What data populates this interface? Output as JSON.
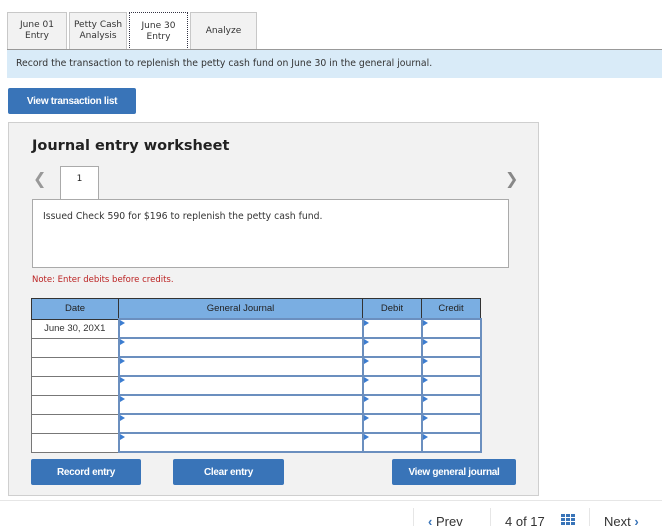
{
  "tabs": [
    {
      "label": "June 01 Entry",
      "active": false
    },
    {
      "label": "Petty Cash Analysis",
      "active": false
    },
    {
      "label": "June 30 Entry",
      "active": true
    },
    {
      "label": "Analyze",
      "active": false
    }
  ],
  "instruction": "Record the transaction to replenish the petty cash fund on June 30 in the general journal.",
  "view_transaction_list_label": "View transaction list",
  "worksheet": {
    "title": "Journal entry worksheet",
    "prev_icon": "chevron-left-icon",
    "next_icon": "chevron-right-icon",
    "current_page": "1",
    "description": "Issued Check 590 for $196 to replenish the petty cash fund.",
    "note": "Note: Enter debits before credits.",
    "table": {
      "headers": [
        "Date",
        "General Journal",
        "Debit",
        "Credit"
      ],
      "rows": [
        {
          "date": "June 30, 20X1",
          "account": "",
          "debit": "",
          "credit": ""
        },
        {
          "date": "",
          "account": "",
          "debit": "",
          "credit": ""
        },
        {
          "date": "",
          "account": "",
          "debit": "",
          "credit": ""
        },
        {
          "date": "",
          "account": "",
          "debit": "",
          "credit": ""
        },
        {
          "date": "",
          "account": "",
          "debit": "",
          "credit": ""
        },
        {
          "date": "",
          "account": "",
          "debit": "",
          "credit": ""
        },
        {
          "date": "",
          "account": "",
          "debit": "",
          "credit": ""
        }
      ]
    },
    "buttons": {
      "record": "Record entry",
      "clear": "Clear entry",
      "view_gj": "View general journal"
    }
  },
  "bottom_nav": {
    "prev_label": "Prev",
    "page_label": "4 of 17",
    "grid_icon": "grid-icon",
    "next_label": "Next"
  },
  "colors": {
    "primary_button": "#3974b8",
    "table_header": "#7aaee2",
    "instruction_bg": "#d9ebf8",
    "note_text": "#b22222"
  }
}
